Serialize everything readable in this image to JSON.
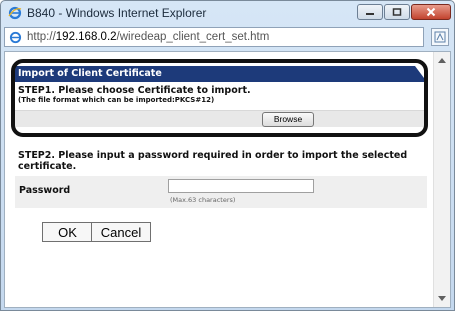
{
  "window": {
    "title": "B840 - Windows Internet Explorer",
    "address_prefix": "http://",
    "address_host": "192.168.0.2",
    "address_path": "/wiredeap_client_cert_set.htm"
  },
  "page": {
    "section_title": "Import of Client Certificate",
    "step1": "STEP1.  Please choose Certificate to import.",
    "step1_note": "(The file format which can be imported:PKCS#12)",
    "browse_label": "Browse",
    "step2": "STEP2.  Please input a password required in order to import the selected certificate.",
    "password_label": "Password",
    "password_value": "",
    "password_hint": "(Max.63 characters)",
    "ok_label": "OK",
    "cancel_label": "Cancel"
  },
  "colors": {
    "section_header": "#1d3a7a",
    "title_bar": "#d6e6f6",
    "close_button": "#c2432e"
  }
}
